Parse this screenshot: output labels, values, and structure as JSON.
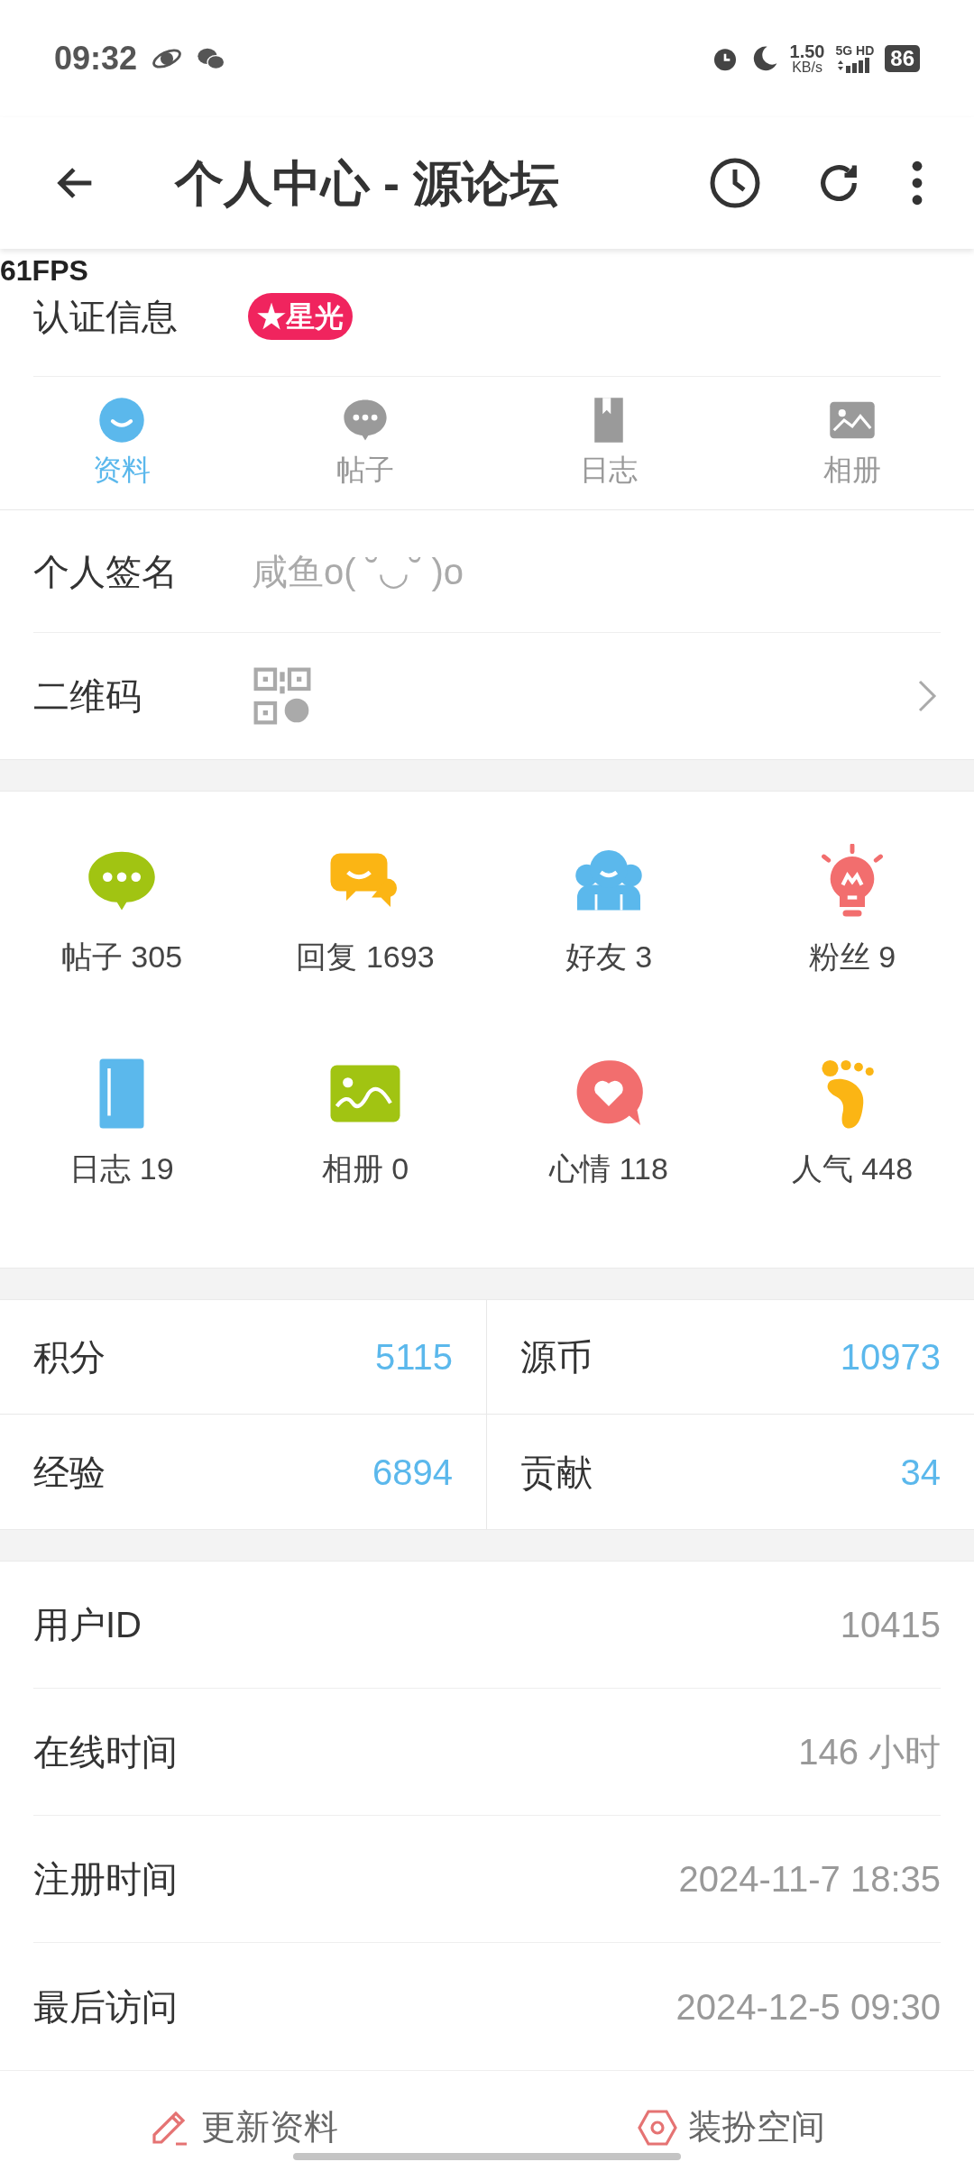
{
  "status_bar": {
    "time": "09:32",
    "speed": "1.50",
    "speed_unit": "KB/s",
    "network": "5G HD",
    "battery": "86"
  },
  "app_bar": {
    "title": "个人中心 - 源论坛"
  },
  "fps_overlay": "61FPS",
  "certification": {
    "label": "认证信息",
    "badge": "★星光"
  },
  "tabs": [
    {
      "label": "资料",
      "kind": "profile",
      "selected": true
    },
    {
      "label": "帖子",
      "kind": "posts",
      "selected": false
    },
    {
      "label": "日志",
      "kind": "diary",
      "selected": false
    },
    {
      "label": "相册",
      "kind": "album",
      "selected": false
    }
  ],
  "signature": {
    "label": "个人签名",
    "value": "咸鱼o( ˘◡˘ )o"
  },
  "qr_code": {
    "label": "二维码"
  },
  "stats": [
    {
      "kind": "posts",
      "label": "帖子 305"
    },
    {
      "kind": "replies",
      "label": "回复 1693"
    },
    {
      "kind": "friends",
      "label": "好友 3"
    },
    {
      "kind": "fans",
      "label": "粉丝 9"
    },
    {
      "kind": "diary",
      "label": "日志 19"
    },
    {
      "kind": "album",
      "label": "相册 0"
    },
    {
      "kind": "mood",
      "label": "心情 118"
    },
    {
      "kind": "popularity",
      "label": "人气 448"
    }
  ],
  "points": [
    {
      "label": "积分",
      "value": "5115"
    },
    {
      "label": "源币",
      "value": "10973"
    },
    {
      "label": "经验",
      "value": "6894"
    },
    {
      "label": "贡献",
      "value": "34"
    }
  ],
  "info": [
    {
      "label": "用户ID",
      "value": "10415"
    },
    {
      "label": "在线时间",
      "value": "146 小时"
    },
    {
      "label": "注册时间",
      "value": "2024-11-7 18:35"
    },
    {
      "label": "最后访问",
      "value": "2024-12-5 09:30"
    }
  ],
  "bottom_actions": [
    {
      "kind": "edit",
      "label": "更新资料"
    },
    {
      "kind": "dress",
      "label": "装扮空间"
    }
  ]
}
